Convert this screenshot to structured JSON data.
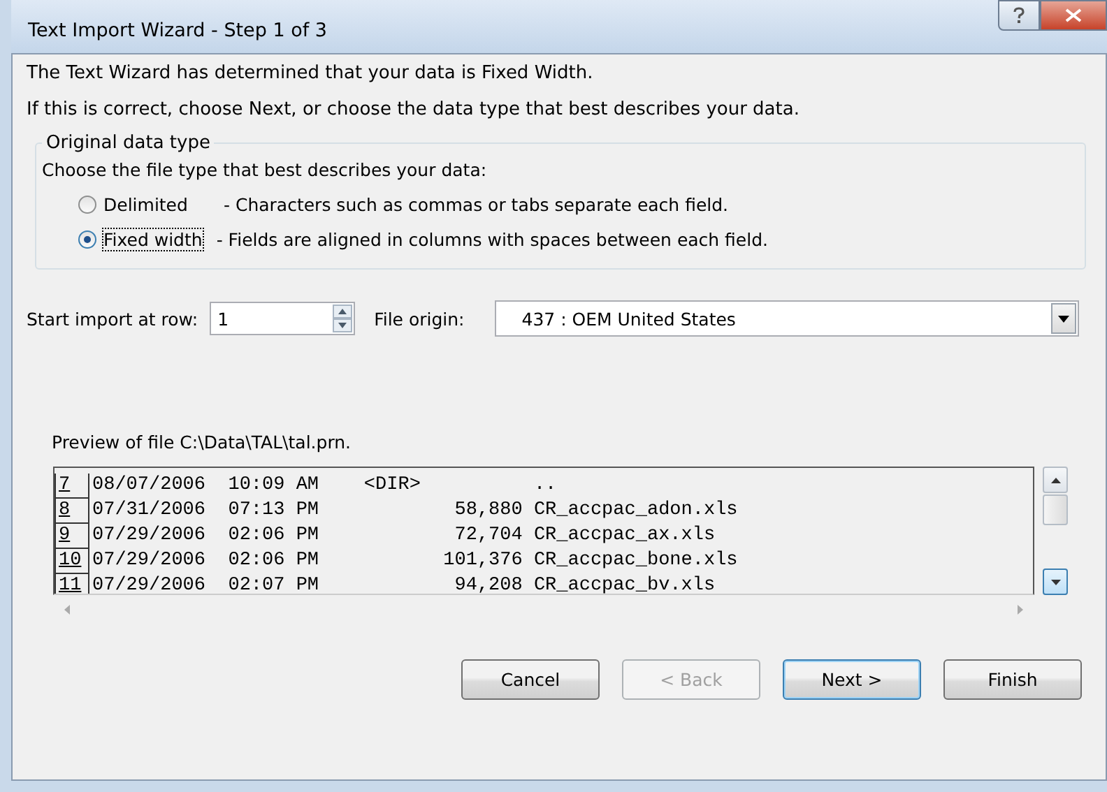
{
  "window": {
    "title": "Text Import Wizard - Step 1 of 3"
  },
  "intro": [
    "The Text Wizard has determined that your data is Fixed Width.",
    "If this is correct, choose Next, or choose the data type that best describes your data."
  ],
  "group": {
    "title": "Original data type",
    "prompt": "Choose the file type that best describes your data:",
    "options": [
      {
        "label": "Delimited",
        "description": "- Characters such as commas or tabs separate each field.",
        "selected": false
      },
      {
        "label": "Fixed width",
        "description": "- Fields are aligned in columns with spaces between each field.",
        "selected": true
      }
    ]
  },
  "start_row": {
    "label": "Start import at row:",
    "value": "1"
  },
  "file_origin": {
    "label": "File origin:",
    "value": "437 : OEM United States"
  },
  "preview": {
    "label": "Preview of file C:\\Data\\TAL\\tal.prn.",
    "rows": [
      {
        "number": "7",
        "text": "08/07/2006  10:09 AM    <DIR>          .."
      },
      {
        "number": "8",
        "text": "07/31/2006  07:13 PM            58,880 CR_accpac_adon.xls"
      },
      {
        "number": "9",
        "text": "07/29/2006  02:06 PM            72,704 CR_accpac_ax.xls"
      },
      {
        "number": "10",
        "text": "07/29/2006  02:06 PM           101,376 CR_accpac_bone.xls"
      },
      {
        "number": "11",
        "text": "07/29/2006  02:07 PM            94,208 CR_accpac_bv.xls"
      }
    ]
  },
  "buttons": [
    {
      "label": "Cancel",
      "disabled": false,
      "default": false
    },
    {
      "label": "< Back",
      "disabled": true,
      "default": false
    },
    {
      "label": "Next >",
      "disabled": false,
      "default": true
    },
    {
      "label": "Finish",
      "disabled": false,
      "default": false
    }
  ]
}
